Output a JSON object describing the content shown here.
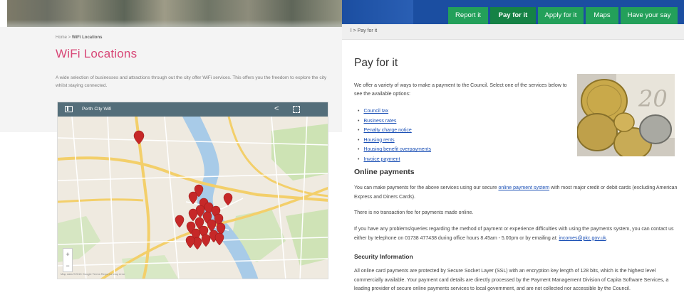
{
  "left": {
    "breadcrumb": {
      "home": "Home",
      "sep": " > ",
      "current": "WiFi Locations"
    },
    "title": "WiFi Locations",
    "intro": "A wide selection of businesses and attractions through out the city offer WiFi services. This offers you the freedom to explore the city whilst staying connected.",
    "map": {
      "title": "Perth City Wifi",
      "zoom_in": "+",
      "zoom_out": "−",
      "attribution": "Map data ©2015 Google   Terms   Report a map error",
      "share_icon": "share-icon",
      "fullscreen_icon": "fullscreen-icon"
    }
  },
  "right": {
    "nav": {
      "tabs": [
        {
          "label": "Report it",
          "active": false
        },
        {
          "label": "Pay for it",
          "active": true
        },
        {
          "label": "Apply for it",
          "active": false
        },
        {
          "label": "Maps",
          "active": false
        },
        {
          "label": "Have your say",
          "active": false
        }
      ],
      "colors": {
        "bar": "#1b4ea1",
        "tab": "#23a05a",
        "tab_active": "#158245"
      }
    },
    "breadcrumb": "l > Pay for it",
    "heading": "Pay for it",
    "intro": "We offer a variety of ways to make a payment to the Council. Select one of the services below to see the available options:",
    "services": [
      "Council tax",
      "Business rates",
      "Penalty charge notice",
      "Housing rents",
      "Housing benefit overpayments",
      "Invoice payment"
    ],
    "online": {
      "heading": "Online payments",
      "p1_before": "You can make payments for the above services using our secure ",
      "p1_link": "online payment system",
      "p1_after": " with most major credit or debit cards (excluding American Express and Diners Cards).",
      "p2": "There is no transaction fee for payments made online.",
      "p3_before": "If you have any problems/queries regarding the method of payment or experience difficulties with using the payments system, you can contact us either by telephone on 01738 477438 during office hours 8.45am - 5.00pm or by emailing at: ",
      "p3_link": "incomes@pkc.gov.uk",
      "p3_after": "."
    },
    "security": {
      "heading": "Security Information",
      "text": "All online card payments are protected by Secure Socket Layer (SSL) with an encryption key length of 128 bits, which is the highest level commercially available. Your payment card details are directly processed by the Payment Management Division of Capita Software Services, a leading provider of secure online payments services to local government, and are not collected nor accessible by the Council."
    },
    "coin_banknote_text": "20"
  }
}
